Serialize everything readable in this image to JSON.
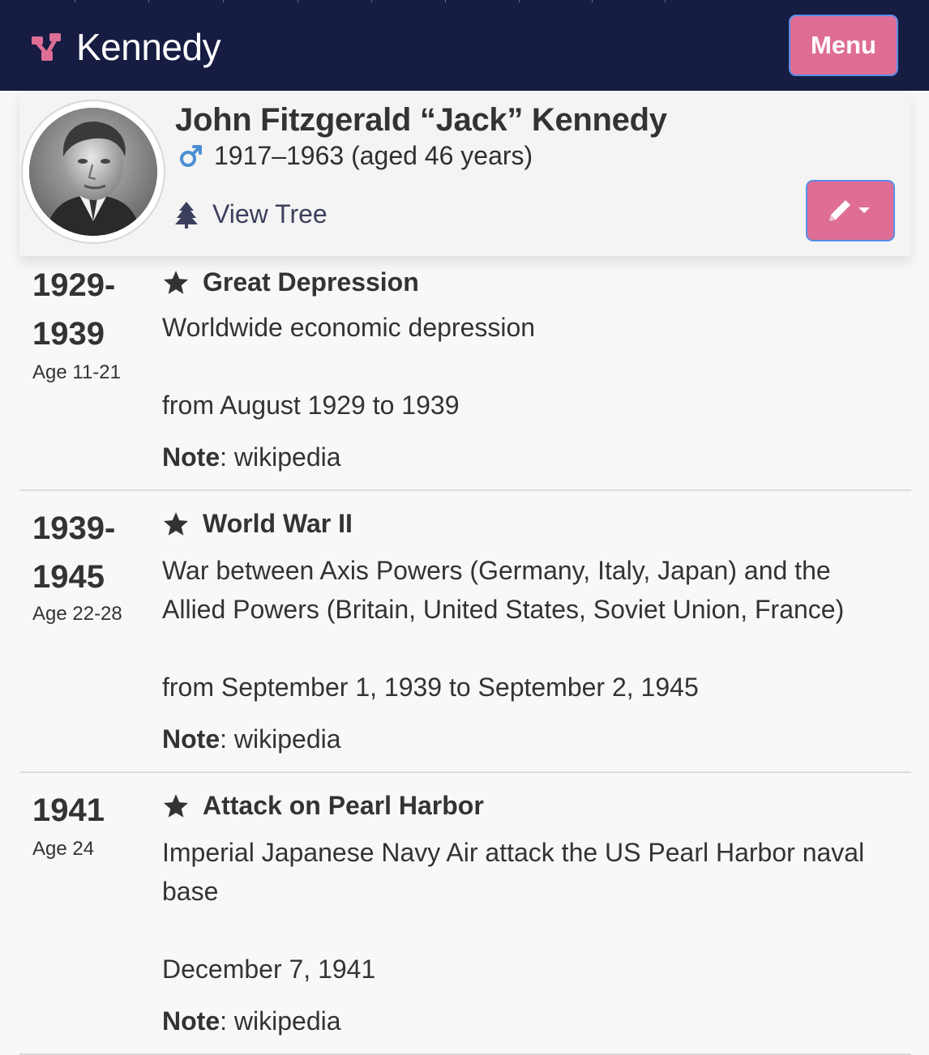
{
  "navbar": {
    "brand": "Kennedy",
    "menu_label": "Menu",
    "brand_color": "#de6e95",
    "background": "#161c42"
  },
  "person": {
    "name": "John Fitzgerald “Jack” Kennedy",
    "gender_icon": "male-icon",
    "dates": "1917–1963 (aged 46 years)",
    "view_tree_label": "View Tree",
    "edit_icon": "pencil-icon"
  },
  "events": [
    {
      "date_start": "1929-",
      "date_end": "1939",
      "age": "Age 11-21",
      "title": "Great Depression",
      "description": "Worldwide economic depression",
      "when": "from August 1929 to 1939",
      "note_label": "Note",
      "note_value": ": wikipedia"
    },
    {
      "date_start": "1939-",
      "date_end": "1945",
      "age": "Age 22-28",
      "title": "World War II",
      "description": "War between Axis Powers (Germany, Italy, Japan) and the Allied Powers (Britain, United States, Soviet Union, France)",
      "when": "from September 1, 1939 to September 2, 1945",
      "note_label": "Note",
      "note_value": ": wikipedia"
    },
    {
      "date_start": "1941",
      "age": "Age 24",
      "title": "Attack on Pearl Harbor",
      "description": "Imperial Japanese Navy Air attack the US Pearl Harbor naval base",
      "when": "December 7, 1941",
      "note_label": "Note",
      "note_value": ": wikipedia"
    }
  ]
}
